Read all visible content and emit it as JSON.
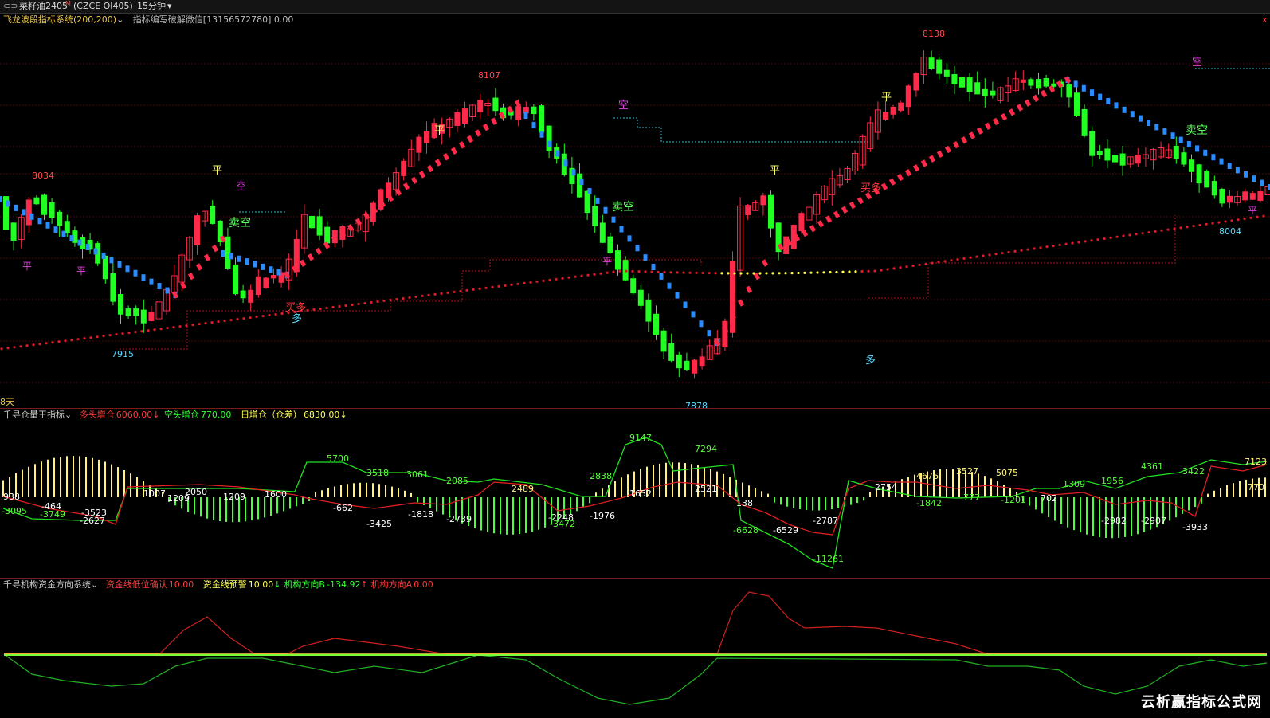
{
  "topbar": {
    "symbol": "菜籽油2405",
    "symbol_sup": "M",
    "contract": "(CZCE OI405)",
    "period": "15分钟",
    "chevron": "▾"
  },
  "main_panel": {
    "indicator_name": "飞龙波段指标系统(200,200)",
    "info_text": "指标编写破解微信[13156572780] 0.00",
    "corner_label": "8天",
    "right_edge_label": "x",
    "price_labels": {
      "p8034": "8034",
      "p7915": "7915",
      "p8107": "8107",
      "p7878": "7878",
      "p8138": "8138",
      "p8004": "8004"
    },
    "signals": {
      "ping": "平",
      "kong": "空",
      "maikong": "卖空",
      "maiduo": "买多",
      "duo": "多"
    },
    "colors": {
      "up": "#ff2a4a",
      "down": "#22ff22",
      "trail_down": "#2a8cff",
      "dot_red": "#e0182a",
      "dot_yellow": "#ffff44",
      "grid": "#5a0f0f"
    }
  },
  "vol_panel": {
    "indicator_name": "千寻仓量王指标",
    "long_label": "多头增仓",
    "long_value": "6060.00",
    "short_label": "空头增仓",
    "short_value": "770.00",
    "daily_label": "日增仓（仓差）",
    "daily_value": "6830.00",
    "arrow_down": "↓",
    "numbers": {
      "n938": "938",
      "n3095": "-3095",
      "n464": "-464",
      "n3749": "-3749",
      "n3523": "-3523",
      "n2627": "-2627",
      "n1007": "1007",
      "n1209": "1209",
      "n2050": "2050",
      "n1209b": "1209",
      "n1600": "1600",
      "n5700": "5700",
      "n3518": "3518",
      "n3061": "3061",
      "n2085": "2085",
      "n662": "-662",
      "n3425": "-3425",
      "n1818": "-1818",
      "n2739": "-2739",
      "n2489": "2489",
      "n2838": "2838",
      "n2248": "-2248",
      "n3472": "-3472",
      "n1976": "-1976",
      "n9147": "9147",
      "n7294": "7294",
      "n1652": "1652",
      "n2521": "2521",
      "n138": "138",
      "n6628": "-6628",
      "n6529": "-6529",
      "n2787": "-2787",
      "n11261": "-11261",
      "n2754": "2754",
      "n4676": "4676",
      "n3527": "3527",
      "n5075": "5075",
      "n1842": "-1842",
      "n777": "-777",
      "n1201": "-1201",
      "n1309": "1309",
      "n702": "702",
      "n1956": "1956",
      "n4361": "4361",
      "n3422": "3422",
      "n2982": "-2982",
      "n2907": "-2907",
      "n3933": "-3933",
      "n7123": "7123",
      "n770": "770"
    }
  },
  "fund_panel": {
    "indicator_name": "千寻机构资金方向系统",
    "low_label": "资金线低位确认",
    "low_value": "10.00",
    "warn_label": "资金线预警",
    "warn_value": "10.00",
    "dir_b_label": "机构方向B",
    "dir_b_value": "-134.92",
    "dir_a_label": "机构方向A",
    "dir_a_value": "0.00",
    "arrow_down": "↓",
    "arrow_up": "↑"
  },
  "watermark": "云析赢指标公式网"
}
